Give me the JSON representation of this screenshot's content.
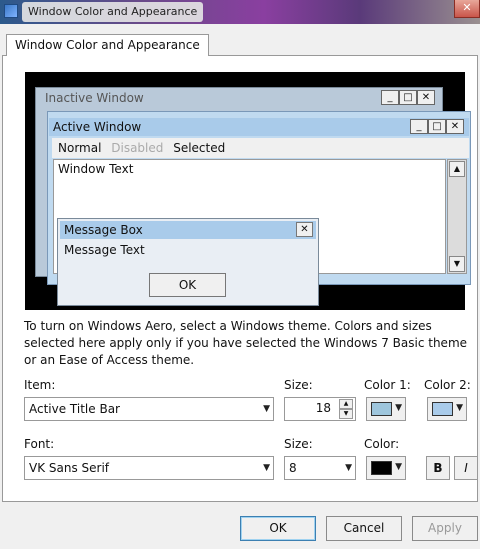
{
  "window": {
    "title": "Window Color and Appearance",
    "close_glyph": "✕"
  },
  "tab": {
    "label": "Window Color and Appearance"
  },
  "preview": {
    "inactive_window_title": "Inactive Window",
    "active_window_title": "Active Window",
    "menu": {
      "normal": "Normal",
      "disabled": "Disabled",
      "selected": "Selected"
    },
    "window_text": "Window Text",
    "message_box": {
      "title": "Message Box",
      "text": "Message Text",
      "ok": "OK"
    }
  },
  "description": "To turn on Windows Aero, select a Windows theme.  Colors and sizes selected here apply only if you have selected the Windows 7 Basic theme or an Ease of Access theme.",
  "item_row": {
    "item_label": "Item:",
    "item_value": "Active Title Bar",
    "size_label": "Size:",
    "size_value": "18",
    "color1_label": "Color 1:",
    "color2_label": "Color 2:",
    "color1": "#9ec6dd",
    "color2": "#a9cbea"
  },
  "font_row": {
    "font_label": "Font:",
    "font_value": "VK Sans Serif",
    "size_label": "Size:",
    "size_value": "8",
    "color_label": "Color:",
    "color": "#000000",
    "bold": "B",
    "italic": "I"
  },
  "buttons": {
    "ok": "OK",
    "cancel": "Cancel",
    "apply": "Apply"
  },
  "icons": {
    "app": "app-icon",
    "minimize": "_",
    "maximize": "□",
    "close": "✕",
    "dropdown": "▼",
    "scroll_up": "▲",
    "scroll_down": "▼"
  }
}
